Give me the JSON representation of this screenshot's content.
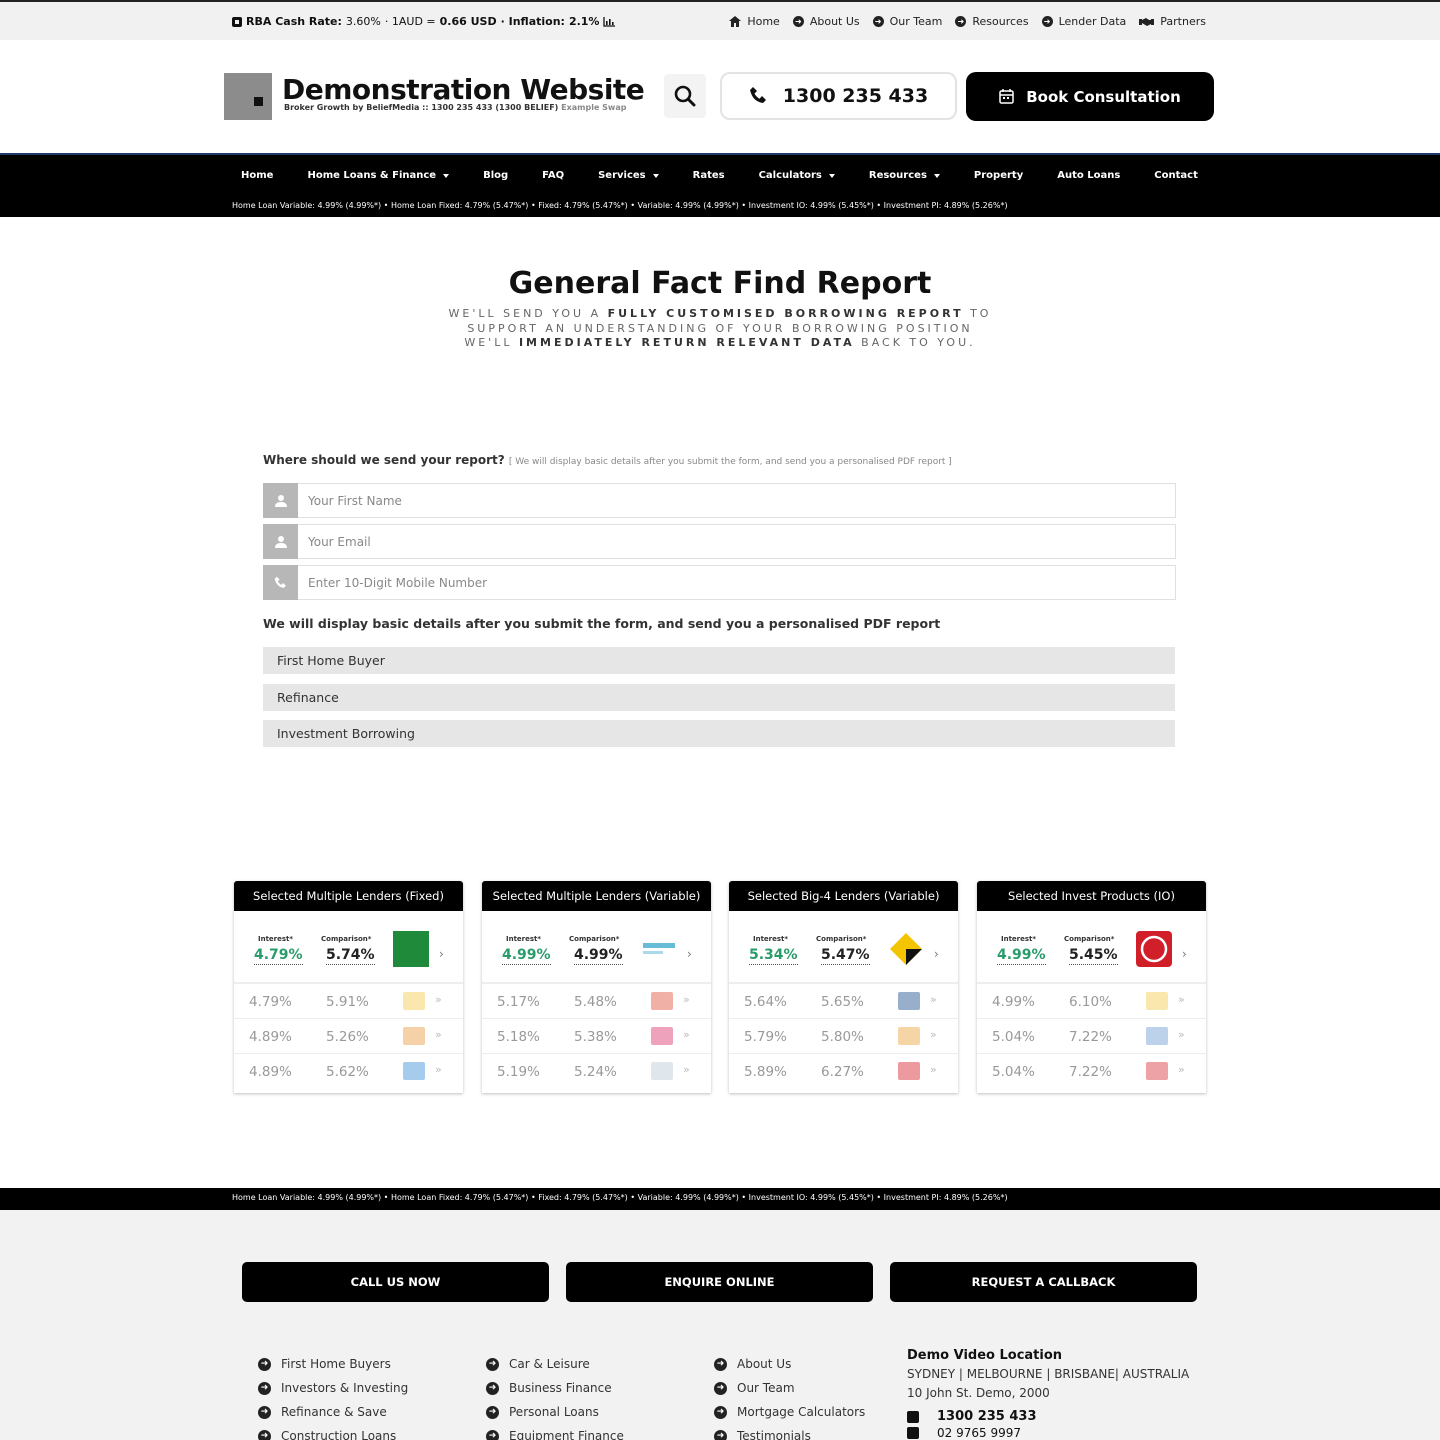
{
  "topbar": {
    "rba_label": "RBA Cash Rate:",
    "rba_value": "3.60%",
    "aud_label": "· 1AUD =",
    "aud_value": "0.66 USD",
    "inflation_label": "· Inflation:",
    "inflation_value": "2.1%",
    "links": [
      "Home",
      "About Us",
      "Our Team",
      "Resources",
      "Lender Data",
      "Partners"
    ]
  },
  "header": {
    "site_title": "Demonstration Website",
    "site_subtitle": "Broker Growth by BeliefMedia :: 1300 235 433 (1300 BELIEF)",
    "site_subtitle_tag": "Example Swap",
    "phone": "1300 235 433",
    "book_label": "Book Consultation"
  },
  "nav": {
    "items": [
      "Home",
      "Home Loans & Finance",
      "Blog",
      "FAQ",
      "Services",
      "Rates",
      "Calculators",
      "Resources",
      "Property",
      "Auto Loans",
      "Contact"
    ],
    "ticker": "Home Loan Variable: 4.99% (4.99%*) • Home Loan Fixed: 4.79% (5.47%*) • Fixed: 4.79% (5.47%*) • Variable: 4.99% (4.99%*) • Investment IO: 4.99% (5.45%*) • Investment PI: 4.89% (5.26%*)"
  },
  "intro": {
    "title": "General Fact Find Report",
    "line1_a": "WE'LL SEND YOU A ",
    "line1_b": "FULLY CUSTOMISED BORROWING REPORT",
    "line1_c": " TO",
    "line2": "SUPPORT AN UNDERSTANDING OF YOUR BORROWING POSITION",
    "line3_a": "WE'LL ",
    "line3_b": "IMMEDIATELY RETURN RELEVANT DATA",
    "line3_c": " BACK TO YOU."
  },
  "form": {
    "label": "Where should we send your report?",
    "label_note": "[ We will display basic details after you submit the form, and send you a personalised PDF report ]",
    "first_name_placeholder": "Your First Name",
    "email_placeholder": "Your Email",
    "mobile_placeholder": "Enter 10-Digit Mobile Number",
    "note": "We will display basic details after you submit the form, and send you a personalised PDF report",
    "options": [
      "First Home Buyer",
      "Refinance",
      "Investment Borrowing"
    ]
  },
  "rate_cards": [
    {
      "title": "Selected Multiple Lenders (Fixed)",
      "interest_label": "Interest*",
      "comparison_label": "Comparison*",
      "featured_interest": "4.79%",
      "featured_comparison": "5.74%",
      "logo_color": "#1f8a3a",
      "rows": [
        [
          "4.79%",
          "5.91%"
        ],
        [
          "4.89%",
          "5.26%"
        ],
        [
          "4.89%",
          "5.62%"
        ]
      ],
      "row_colors": [
        "#f3c94a",
        "#e89a3c",
        "#3a8fd6"
      ]
    },
    {
      "title": "Selected Multiple Lenders (Variable)",
      "interest_label": "Interest*",
      "comparison_label": "Comparison*",
      "featured_interest": "4.99%",
      "featured_comparison": "4.99%",
      "logo_color": "#2aa0c8",
      "rows": [
        [
          "5.17%",
          "5.48%"
        ],
        [
          "5.18%",
          "5.38%"
        ],
        [
          "5.19%",
          "5.24%"
        ]
      ],
      "row_colors": [
        "#e0503a",
        "#d9306a",
        "#b8c9d6"
      ]
    },
    {
      "title": "Selected Big-4 Lenders (Variable)",
      "interest_label": "Interest*",
      "comparison_label": "Comparison*",
      "featured_interest": "5.34%",
      "featured_comparison": "5.47%",
      "logo_color": "#f5c400",
      "rows": [
        [
          "5.64%",
          "5.65%"
        ],
        [
          "5.79%",
          "5.80%"
        ],
        [
          "5.89%",
          "6.27%"
        ]
      ],
      "row_colors": [
        "#1b4d8c",
        "#e8a23a",
        "#d4202a"
      ]
    },
    {
      "title": "Selected Invest Products (IO)",
      "interest_label": "Interest*",
      "comparison_label": "Comparison*",
      "featured_interest": "4.99%",
      "featured_comparison": "5.45%",
      "logo_color": "#d11f2a",
      "rows": [
        [
          "4.99%",
          "6.10%"
        ],
        [
          "5.04%",
          "7.22%"
        ],
        [
          "5.04%",
          "7.22%"
        ]
      ],
      "row_colors": [
        "#f3c94a",
        "#6a9ad0",
        "#d8303a"
      ]
    }
  ],
  "footer": {
    "ticker": "Home Loan Variable: 4.99% (4.99%*) • Home Loan Fixed: 4.79% (5.47%*) • Fixed: 4.79% (5.47%*) • Variable: 4.99% (4.99%*) • Investment IO: 4.99% (5.45%*) • Investment PI: 4.89% (5.26%*)",
    "cta": [
      "CALL US NOW",
      "ENQUIRE ONLINE",
      "REQUEST A CALLBACK"
    ],
    "col1": [
      "First Home Buyers",
      "Investors & Investing",
      "Refinance & Save",
      "Construction Loans"
    ],
    "col2": [
      "Car & Leisure",
      "Business Finance",
      "Personal Loans",
      "Equipment Finance"
    ],
    "col3": [
      "About Us",
      "Our Team",
      "Mortgage Calculators",
      "Testimonials"
    ],
    "location_title": "Demo Video Location",
    "location_cities": "SYDNEY | MELBOURNE | BRISBANE| AUSTRALIA",
    "location_address": "10 John St. Demo, 2000",
    "location_phone": "1300 235 433",
    "location_phone2": "02 9765 9997"
  },
  "colors": {
    "accent_black": "#000000",
    "interest_green": "#2a9c6b",
    "nav_border_blue": "#1f3a6e"
  }
}
